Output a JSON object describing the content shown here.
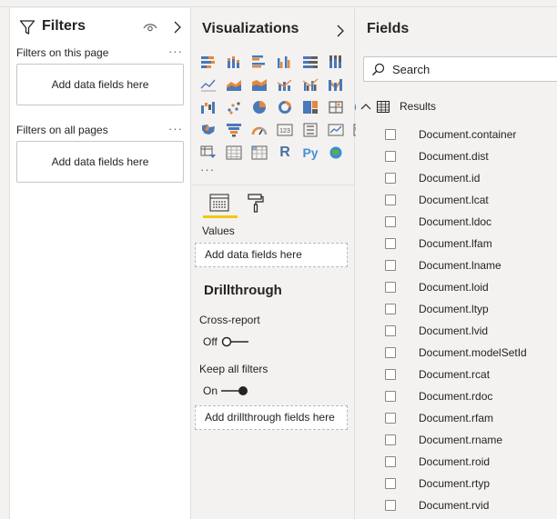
{
  "filters": {
    "title": "Filters",
    "page_label": "Filters on this page",
    "page_drop": "Add data fields here",
    "all_label": "Filters on all pages",
    "all_drop": "Add data fields here",
    "more": "···"
  },
  "viz": {
    "title": "Visualizations",
    "more": "···",
    "r_label": "R",
    "py_label": "Py",
    "values_label": "Values",
    "values_drop": "Add data fields here",
    "drill_title": "Drillthrough",
    "cross_report_label": "Cross-report",
    "cross_report_state": "Off",
    "keep_filters_label": "Keep all filters",
    "keep_filters_state": "On",
    "drill_drop": "Add drillthrough fields here",
    "accent_color": "#f2c811"
  },
  "fields": {
    "title": "Fields",
    "search_placeholder": "Search",
    "table_name": "Results",
    "items": [
      "Document.container",
      "Document.dist",
      "Document.id",
      "Document.lcat",
      "Document.ldoc",
      "Document.lfam",
      "Document.lname",
      "Document.loid",
      "Document.ltyp",
      "Document.lvid",
      "Document.modelSetId",
      "Document.rcat",
      "Document.rdoc",
      "Document.rfam",
      "Document.rname",
      "Document.roid",
      "Document.rtyp",
      "Document.rvid"
    ]
  }
}
